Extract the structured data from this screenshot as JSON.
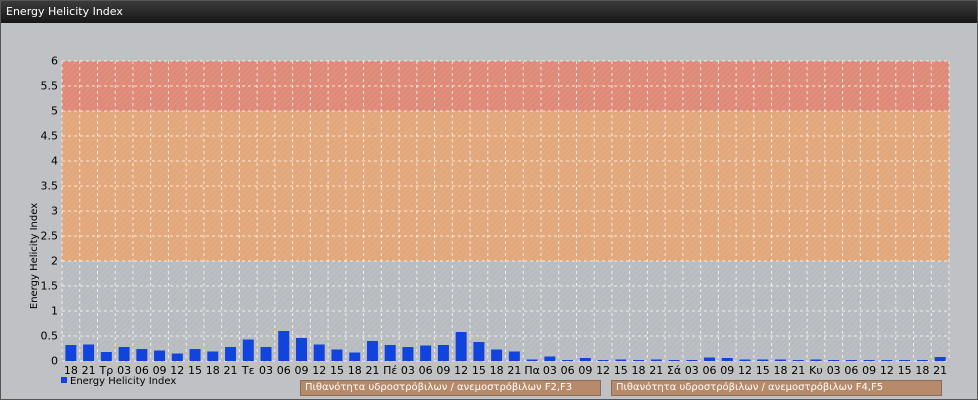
{
  "window": {
    "title": "Energy Helicity Index"
  },
  "colors": {
    "bar": "#1144dd",
    "band_low": "#b8bcc0",
    "band_mid": "#e2a77b",
    "band_high": "#df8a78",
    "grid": "#ffffff"
  },
  "legend_boxes": [
    {
      "label": "Πιθανότητα υδροστρόβιλων / ανεμοστρόβιλων F2,F3"
    },
    {
      "label": "Πιθανότητα υδροστρόβιλων / ανεμοστρόβιλων F4,F5"
    }
  ],
  "chart_data": {
    "type": "bar",
    "title": "Energy Helicity Index",
    "ylabel": "Energy Helicity Index",
    "xlabel": "",
    "ylim": [
      0,
      6
    ],
    "yticks": [
      0,
      0.5,
      1,
      1.5,
      2,
      2.5,
      3,
      3.5,
      4,
      4.5,
      5,
      5.5,
      6
    ],
    "grid": true,
    "legend": "bottom-left",
    "bands": [
      {
        "from": 0,
        "to": 2,
        "color": "#b8bcc0"
      },
      {
        "from": 2,
        "to": 5,
        "color": "#e2a77b",
        "label": "Πιθανότητα υδροστρόβιλων / ανεμοστρόβιλων F2,F3"
      },
      {
        "from": 5,
        "to": 6,
        "color": "#df8a78",
        "label": "Πιθανότητα υδροστρόβιλων / ανεμοστρόβιλων F4,F5"
      }
    ],
    "categories": [
      "18",
      "21",
      "Τρ",
      "03",
      "06",
      "09",
      "12",
      "15",
      "18",
      "21",
      "Τε",
      "03",
      "06",
      "09",
      "12",
      "15",
      "18",
      "21",
      "Πέ",
      "03",
      "06",
      "09",
      "12",
      "15",
      "18",
      "21",
      "Πα",
      "03",
      "06",
      "09",
      "12",
      "15",
      "18",
      "21",
      "Σά",
      "03",
      "06",
      "09",
      "12",
      "15",
      "18",
      "21",
      "Κυ",
      "03",
      "06",
      "09",
      "12",
      "15",
      "18",
      "21"
    ],
    "series": [
      {
        "name": "Energy Helicity Index",
        "values": [
          0.32,
          0.33,
          0.18,
          0.28,
          0.24,
          0.21,
          0.15,
          0.24,
          0.19,
          0.28,
          0.43,
          0.28,
          0.6,
          0.46,
          0.33,
          0.23,
          0.17,
          0.4,
          0.32,
          0.28,
          0.31,
          0.32,
          0.58,
          0.38,
          0.23,
          0.19,
          0.03,
          0.09,
          0.02,
          0.06,
          0.02,
          0.03,
          0.02,
          0.03,
          0.02,
          0.02,
          0.07,
          0.06,
          0.03,
          0.03,
          0.03,
          0.02,
          0.03,
          0.02,
          0.02,
          0.02,
          0.02,
          0.02,
          0.02,
          0.08
        ]
      }
    ]
  }
}
